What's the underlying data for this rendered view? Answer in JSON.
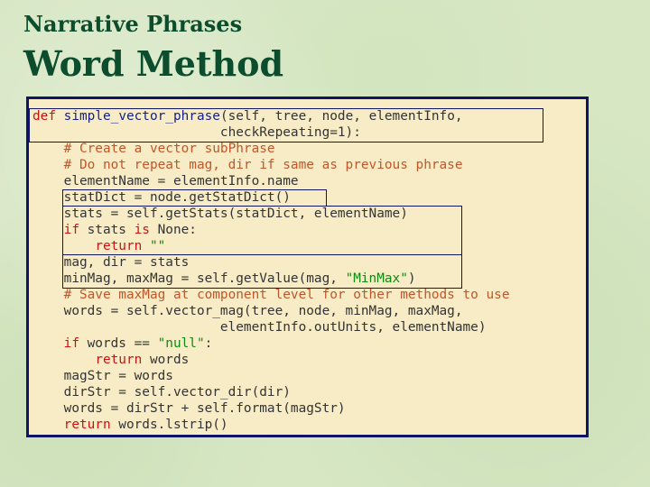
{
  "slide": {
    "title_line1": "Narrative Phrases",
    "title_line2": "Word Method"
  },
  "code": {
    "lines": [
      [
        {
          "t": "def",
          "c": "kw"
        },
        {
          "t": " "
        },
        {
          "t": "simple_vector_phrase",
          "c": "fn"
        },
        {
          "t": "(self, tree, node, elementInfo,"
        }
      ],
      [
        {
          "t": "                        checkRepeating=1):"
        }
      ],
      [
        {
          "t": "    "
        },
        {
          "t": "# Create a vector subPhrase",
          "c": "cm"
        }
      ],
      [
        {
          "t": "    "
        },
        {
          "t": "# Do not repeat mag, dir if same as previous phrase",
          "c": "cm"
        }
      ],
      [
        {
          "t": "    elementName = elementInfo.name"
        }
      ],
      [
        {
          "t": "    statDict = node.getStatDict()"
        }
      ],
      [
        {
          "t": "    stats = self.getStats(statDict, elementName)"
        }
      ],
      [
        {
          "t": "    "
        },
        {
          "t": "if",
          "c": "kw"
        },
        {
          "t": " stats "
        },
        {
          "t": "is",
          "c": "kw"
        },
        {
          "t": " None:"
        }
      ],
      [
        {
          "t": "        "
        },
        {
          "t": "return",
          "c": "kw"
        },
        {
          "t": " "
        },
        {
          "t": "\"\"",
          "c": "str"
        }
      ],
      [
        {
          "t": "    mag, dir = stats"
        }
      ],
      [
        {
          "t": "    minMag, maxMag = self.getValue(mag, "
        },
        {
          "t": "\"MinMax\"",
          "c": "str"
        },
        {
          "t": ")"
        }
      ],
      [
        {
          "t": "    "
        },
        {
          "t": "# Save maxMag at component level for other methods to use",
          "c": "cm"
        }
      ],
      [
        {
          "t": "    words = self.vector_mag(tree, node, minMag, maxMag,"
        }
      ],
      [
        {
          "t": "                        elementInfo.outUnits, elementName)"
        }
      ],
      [
        {
          "t": "    "
        },
        {
          "t": "if",
          "c": "kw"
        },
        {
          "t": " words == "
        },
        {
          "t": "\"null\"",
          "c": "str"
        },
        {
          "t": ":"
        }
      ],
      [
        {
          "t": "        "
        },
        {
          "t": "return",
          "c": "kw"
        },
        {
          "t": " words"
        }
      ],
      [
        {
          "t": "    magStr = words"
        }
      ],
      [
        {
          "t": "    dirStr = self.vector_dir(dir)"
        }
      ],
      [
        {
          "t": "    words = dirStr + self.format(magStr)"
        }
      ],
      [
        {
          "t": "    "
        },
        {
          "t": "return",
          "c": "kw"
        },
        {
          "t": " words.lstrip()"
        }
      ]
    ]
  }
}
